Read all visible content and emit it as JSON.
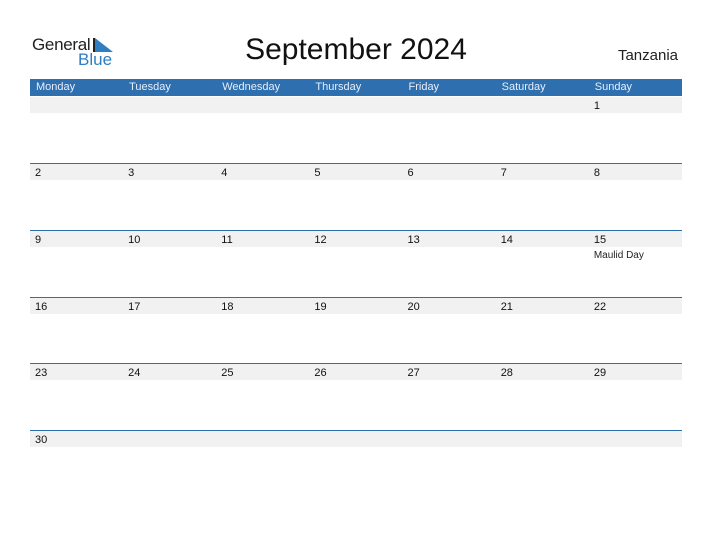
{
  "logo": {
    "general": "General",
    "blue": "Blue"
  },
  "title": "September 2024",
  "country": "Tanzania",
  "weekdays": [
    "Monday",
    "Tuesday",
    "Wednesday",
    "Thursday",
    "Friday",
    "Saturday",
    "Sunday"
  ],
  "weeks": [
    [
      {
        "d": ""
      },
      {
        "d": ""
      },
      {
        "d": ""
      },
      {
        "d": ""
      },
      {
        "d": ""
      },
      {
        "d": ""
      },
      {
        "d": "1"
      }
    ],
    [
      {
        "d": "2"
      },
      {
        "d": "3"
      },
      {
        "d": "4"
      },
      {
        "d": "5"
      },
      {
        "d": "6"
      },
      {
        "d": "7"
      },
      {
        "d": "8"
      }
    ],
    [
      {
        "d": "9"
      },
      {
        "d": "10"
      },
      {
        "d": "11"
      },
      {
        "d": "12"
      },
      {
        "d": "13"
      },
      {
        "d": "14"
      },
      {
        "d": "15",
        "holiday": "Maulid Day"
      }
    ],
    [
      {
        "d": "16"
      },
      {
        "d": "17"
      },
      {
        "d": "18"
      },
      {
        "d": "19"
      },
      {
        "d": "20"
      },
      {
        "d": "21"
      },
      {
        "d": "22"
      }
    ],
    [
      {
        "d": "23"
      },
      {
        "d": "24"
      },
      {
        "d": "25"
      },
      {
        "d": "26"
      },
      {
        "d": "27"
      },
      {
        "d": "28"
      },
      {
        "d": "29"
      }
    ],
    [
      {
        "d": "30"
      },
      {
        "d": ""
      },
      {
        "d": ""
      },
      {
        "d": ""
      },
      {
        "d": ""
      },
      {
        "d": ""
      },
      {
        "d": ""
      }
    ]
  ],
  "colors": {
    "accent": "#2e6fb0",
    "logo_blue": "#2f7ec3",
    "band": "#f1f1f1"
  }
}
